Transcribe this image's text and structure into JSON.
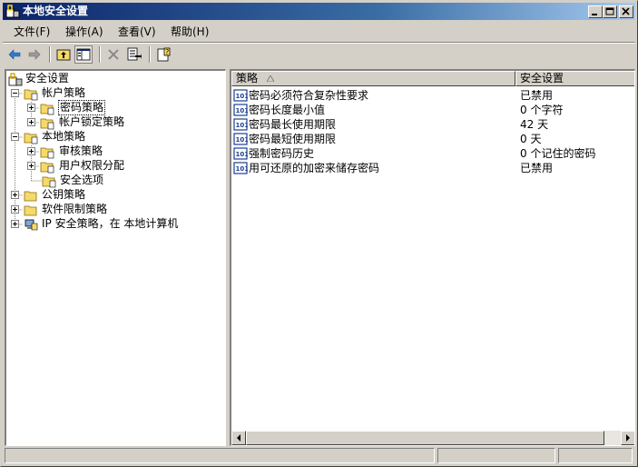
{
  "window": {
    "title": "本地安全设置"
  },
  "menu": [
    {
      "label": "文件(F)"
    },
    {
      "label": "操作(A)"
    },
    {
      "label": "查看(V)"
    },
    {
      "label": "帮助(H)"
    }
  ],
  "toolbar": {
    "icons": [
      "back-arrow-icon",
      "forward-arrow-icon",
      "up-folder-icon",
      "show-hide-tree-icon",
      "delete-icon",
      "export-list-icon",
      "help-icon"
    ]
  },
  "tree": {
    "root": "安全设置",
    "account_policies": "帐户策略",
    "password_policy": "密码策略",
    "lockout_policy": "帐户锁定策略",
    "local_policies": "本地策略",
    "audit_policy": "审核策略",
    "user_rights": "用户权限分配",
    "security_options": "安全选项",
    "public_key": "公钥策略",
    "software_restriction": "软件限制策略",
    "ip_security": "IP 安全策略，在 本地计算机"
  },
  "list": {
    "columns": {
      "policy": "策略",
      "setting": "安全设置"
    },
    "rows": [
      {
        "policy": "密码必须符合复杂性要求",
        "setting": "已禁用"
      },
      {
        "policy": "密码长度最小值",
        "setting": "0 个字符"
      },
      {
        "policy": "密码最长使用期限",
        "setting": "42 天"
      },
      {
        "policy": "密码最短使用期限",
        "setting": "0 天"
      },
      {
        "policy": "强制密码历史",
        "setting": "0 个记住的密码"
      },
      {
        "policy": "用可还原的加密来储存密码",
        "setting": "已禁用"
      }
    ]
  },
  "colors": {
    "title_start": "#0a246a",
    "title_end": "#a6caf0",
    "folder": "#f6d96b",
    "face": "#d4d0c8"
  }
}
